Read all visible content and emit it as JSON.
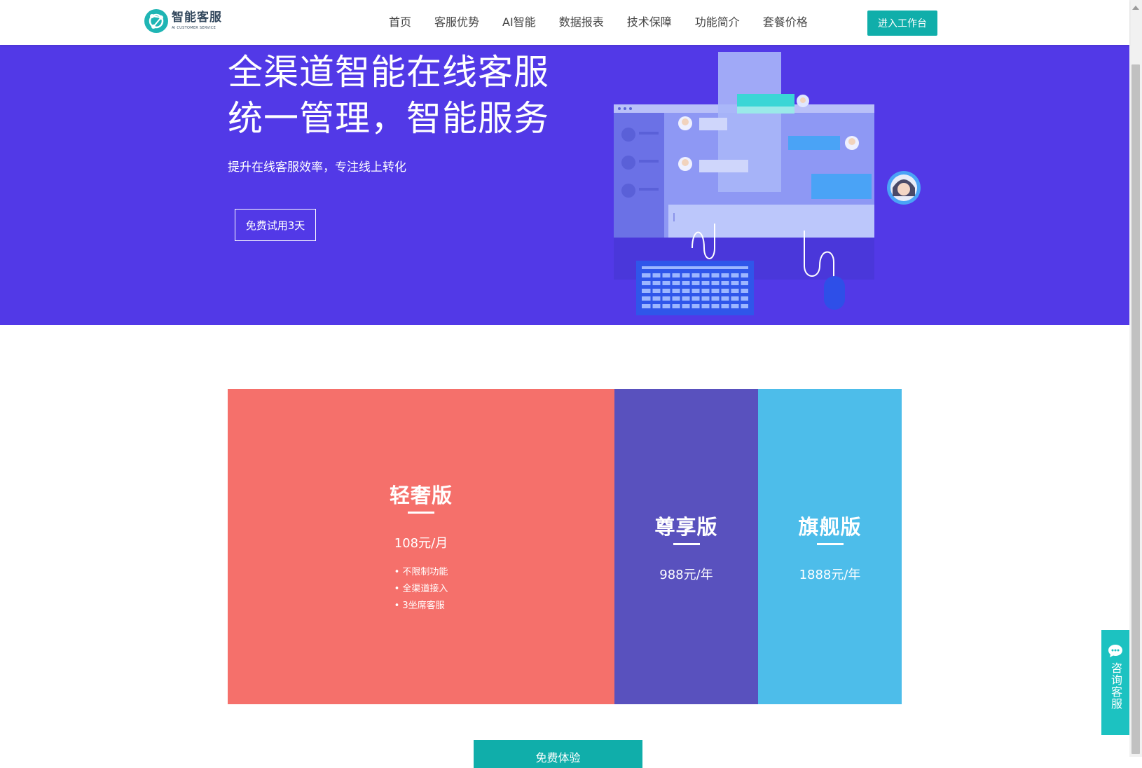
{
  "header": {
    "logo_title": "智能客服",
    "logo_subtitle": "AI CUSTOMER SERVICE",
    "nav": [
      "首页",
      "客服优势",
      "AI智能",
      "数据报表",
      "技术保障",
      "功能简介",
      "套餐价格"
    ],
    "workbench_button": "进入工作台"
  },
  "hero": {
    "title_line1": "全渠道智能在线客服",
    "title_line2": "统一管理，智能服务",
    "subtitle": "提升在线客服效率，专注线上转化",
    "trial_button": "免费试用3天",
    "background_color": "#5239e7"
  },
  "pricing": {
    "plans": [
      {
        "name": "轻奢版",
        "price": "108元/月",
        "features": [
          "不限制功能",
          "全渠道接入",
          "3坐席客服"
        ],
        "color": "#f5706b"
      },
      {
        "name": "尊享版",
        "price": "988元/年",
        "color": "#5951be"
      },
      {
        "name": "旗舰版",
        "price": "1888元/年",
        "color": "#4dbdea"
      }
    ],
    "cta_button": "免费体验"
  },
  "float_consult": {
    "label": "咨询客服"
  }
}
